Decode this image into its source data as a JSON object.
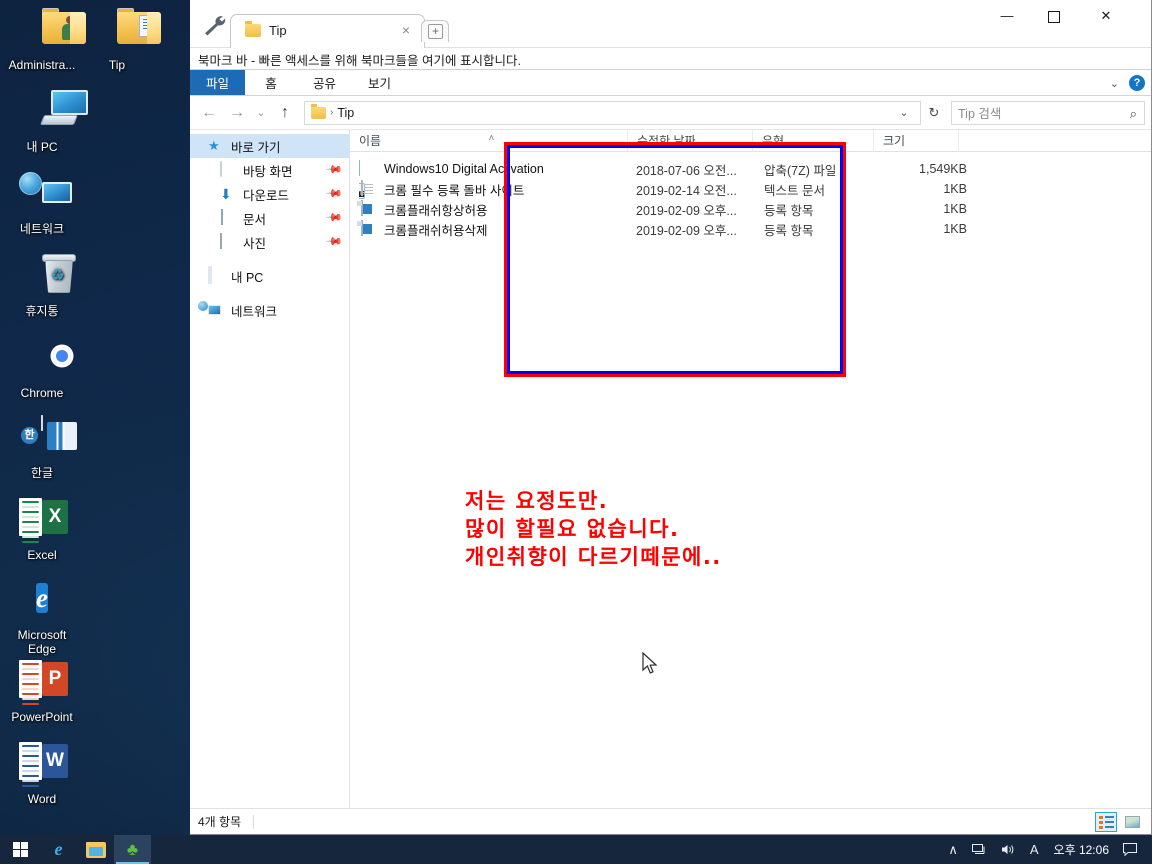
{
  "desktop": {
    "icons": [
      {
        "label": "Administra...",
        "icon": "user-folder-icon"
      },
      {
        "label": "Tip",
        "icon": "folder-icon"
      },
      {
        "label": "내 PC",
        "icon": "this-pc-icon"
      },
      {
        "label": "네트워크",
        "icon": "network-icon"
      },
      {
        "label": "휴지통",
        "icon": "recycle-bin-icon"
      },
      {
        "label": "Chrome",
        "icon": "chrome-icon"
      },
      {
        "label": "한글",
        "icon": "hangul-icon"
      },
      {
        "label": "Excel",
        "icon": "excel-icon"
      },
      {
        "label": "Microsoft Edge",
        "icon": "edge-icon"
      },
      {
        "label": "PowerPoint",
        "icon": "powerpoint-icon"
      },
      {
        "label": "Word",
        "icon": "word-icon"
      }
    ]
  },
  "window": {
    "tab": {
      "title": "Tip",
      "close": "×"
    },
    "new_tab": "+",
    "controls": {
      "minimize": "—",
      "maximize": "☐",
      "close": "✕"
    },
    "bookmark_bar": "북마크 바 - 빠른 액세스를 위해 북마크들을 여기에 표시합니다."
  },
  "ribbon": {
    "tabs": [
      {
        "label": "파일",
        "active": true
      },
      {
        "label": "홈",
        "active": false
      },
      {
        "label": "공유",
        "active": false
      },
      {
        "label": "보기",
        "active": false
      }
    ],
    "expand_chevron": "⌄",
    "help": "?"
  },
  "address": {
    "back": "←",
    "forward": "→",
    "recent": "⌄",
    "up": "↑",
    "breadcrumb": "Tip",
    "separator": "›",
    "dropdown_chevron": "⌄",
    "refresh": "↻"
  },
  "search": {
    "placeholder": "Tip 검색",
    "icon": "⌕"
  },
  "navpane": {
    "items": [
      {
        "label": "바로 가기",
        "icon": "quick-access-star-icon",
        "indent": false,
        "selected": true,
        "pin": false
      },
      {
        "label": "바탕 화면",
        "icon": "desktop-icon",
        "indent": true,
        "selected": false,
        "pin": true
      },
      {
        "label": "다운로드",
        "icon": "downloads-icon",
        "indent": true,
        "selected": false,
        "pin": true
      },
      {
        "label": "문서",
        "icon": "documents-icon",
        "indent": true,
        "selected": false,
        "pin": true
      },
      {
        "label": "사진",
        "icon": "pictures-icon",
        "indent": true,
        "selected": false,
        "pin": true
      },
      {
        "label": "내 PC",
        "icon": "this-pc-icon",
        "indent": false,
        "selected": false,
        "pin": false
      },
      {
        "label": "네트워크",
        "icon": "network-icon",
        "indent": false,
        "selected": false,
        "pin": false
      }
    ]
  },
  "filelist": {
    "columns": [
      {
        "label": "이름",
        "sort": "˄"
      },
      {
        "label": "수정한 날짜",
        "sort": ""
      },
      {
        "label": "유형",
        "sort": ""
      },
      {
        "label": "크기",
        "sort": ""
      }
    ],
    "rows": [
      {
        "name": "Windows10 Digital Activation",
        "date": "2018-07-06 오전...",
        "type": "압축(7Z) 파일",
        "size": "1,549KB",
        "icon": "7zip-archive-icon"
      },
      {
        "name": "크롬 필수 등록 돌바 사이트",
        "date": "2019-02-14 오전...",
        "type": "텍스트 문서",
        "size": "1KB",
        "icon": "text-file-icon"
      },
      {
        "name": "크롬플래쉬항상허용",
        "date": "2019-02-09 오후...",
        "type": "등록 항목",
        "size": "1KB",
        "icon": "registry-file-icon"
      },
      {
        "name": "크롬플래쉬허용삭제",
        "date": "2019-02-09 오후...",
        "type": "등록 항목",
        "size": "1KB",
        "icon": "registry-file-icon"
      }
    ]
  },
  "annotation": {
    "text": "저는 요정도만.\n많이 할필요 없습니다.\n개인취향이 다르기떼문에..",
    "color": "#ff0000",
    "box_outer_color": "#ff0000",
    "box_inner_color": "#0000ff"
  },
  "statusbar": {
    "item_count": "4개 항목",
    "views": [
      {
        "name": "details-view",
        "selected": true
      },
      {
        "name": "thumbnail-view",
        "selected": false
      }
    ]
  },
  "taskbar": {
    "start": "start-icon",
    "buttons": [
      {
        "icon": "edge-icon",
        "active": false
      },
      {
        "icon": "file-explorer-icon",
        "active": false
      },
      {
        "icon": "clover-icon",
        "active": true
      }
    ],
    "tray": {
      "chevron": "∧",
      "network": "🖧",
      "volume": "🔊",
      "ime": "A",
      "clock": "오후 12:06",
      "notifications": "💬"
    }
  }
}
